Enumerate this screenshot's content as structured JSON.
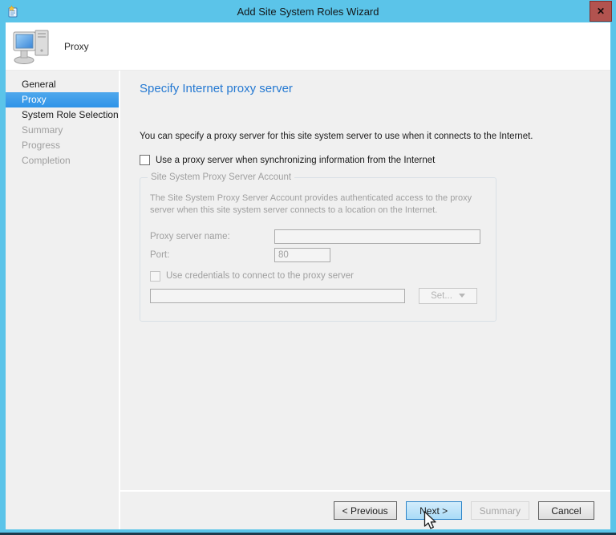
{
  "window": {
    "title": "Add Site System Roles Wizard",
    "close_glyph": "✕"
  },
  "header": {
    "page_label": "Proxy"
  },
  "sidebar": {
    "items": [
      {
        "label": "General",
        "state": "enabled"
      },
      {
        "label": "Proxy",
        "state": "selected"
      },
      {
        "label": "System Role Selection",
        "state": "enabled"
      },
      {
        "label": "Summary",
        "state": "disabled"
      },
      {
        "label": "Progress",
        "state": "disabled"
      },
      {
        "label": "Completion",
        "state": "disabled"
      }
    ]
  },
  "main": {
    "heading": "Specify Internet proxy server",
    "description": "You can specify a proxy server for this site system server to use when it connects to the Internet.",
    "use_proxy_checkbox": {
      "label": "Use a proxy server when synchronizing information from the Internet",
      "checked": false
    },
    "group": {
      "legend": "Site System Proxy Server Account",
      "description": "The Site System Proxy Server Account provides authenticated access to the proxy server when this site system server connects to a location on the Internet.",
      "proxy_server_name": {
        "label": "Proxy server name:",
        "value": ""
      },
      "port": {
        "label": "Port:",
        "value": "80"
      },
      "credentials_checkbox": {
        "label": "Use credentials to connect to the proxy server",
        "checked": false
      },
      "account_value": "",
      "set_button_label": "Set..."
    }
  },
  "footer": {
    "previous_label": "< Previous",
    "next_label": "Next >",
    "summary_label": "Summary",
    "cancel_label": "Cancel"
  },
  "colors": {
    "titlebar_blue": "#5bc4e9",
    "heading_blue": "#2579d2",
    "selected_item_blue": "#2e93e8",
    "close_button_red": "#b2534f",
    "dialog_gray": "#f0f0f0"
  }
}
